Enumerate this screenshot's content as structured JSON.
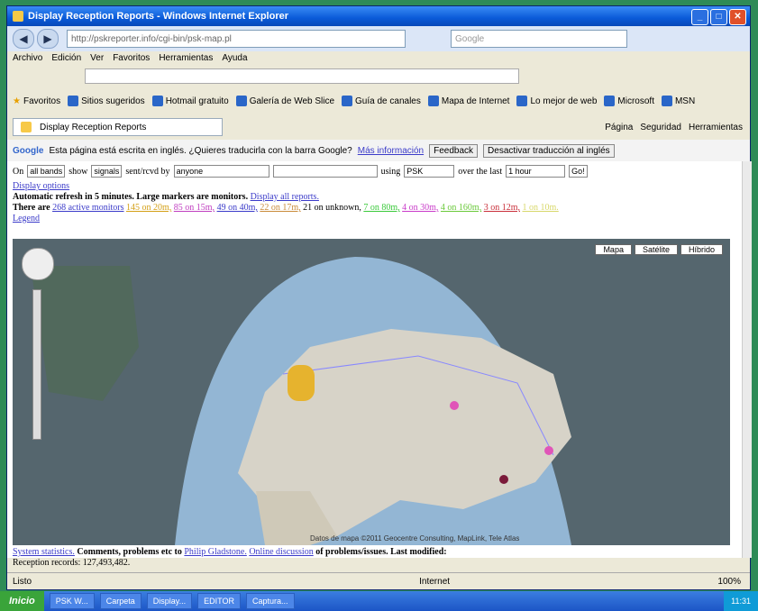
{
  "window": {
    "title": "Display Reception Reports - Windows Internet Explorer"
  },
  "address": {
    "url": "http://pskreporter.info/cgi-bin/psk-map.pl",
    "search_placeholder": "Google"
  },
  "menu": [
    "Archivo",
    "Edición",
    "Ver",
    "Favoritos",
    "Herramientas",
    "Ayuda"
  ],
  "favorites": {
    "label": "Favoritos",
    "items": [
      "Sitios sugeridos",
      "Hotmail gratuito",
      "Galería de Web Slice",
      "Guía de canales",
      "Mapa de Internet",
      "Lo mejor de web",
      "Microsoft",
      "MSN"
    ]
  },
  "tab": {
    "label": "Display Reception Reports"
  },
  "tools": [
    "Página",
    "Seguridad",
    "Herramientas"
  ],
  "translate": {
    "message": "Esta página está escrita en inglés. ¿Quieres traducirla con la barra Google?",
    "more_info": "Más información",
    "feedback": "Feedback",
    "button": "Desactivar traducción al inglés"
  },
  "controls": {
    "on": "On",
    "on_value": "all bands",
    "show": "show",
    "show_value": "signals",
    "sent": "sent/rcvd by",
    "sent_value": "anyone",
    "using": "using",
    "using_value": "PSK",
    "over": "over the last",
    "over_value": "1 hour",
    "go": "Go!"
  },
  "links": {
    "display_options": "Display options",
    "auto_refresh": "Automatic refresh in 5 minutes. Large markers are monitors.",
    "display_all": "Display all reports.",
    "there_are": "There are",
    "active_monitors": "268 active monitors",
    "bands": [
      "145 on 20m,",
      "85 on 15m,",
      "49 on 40m,",
      "22 on 17m,",
      "21 on unknown,",
      "7 on 80m,",
      "4 on 30m,",
      "4 on 160m,",
      "3 on 12m,",
      "1 on 10m."
    ],
    "legend": "Legend"
  },
  "map": {
    "buttons": [
      "Mapa",
      "Satélite",
      "Híbrido"
    ],
    "attribution": "Datos de mapa ©2011 Geocentre Consulting, MapLink, Tele Atlas"
  },
  "footer": {
    "stats": "System statistics.",
    "comments": "Comments, problems etc to",
    "philip": "Philip Gladstone.",
    "online": "Online discussion",
    "problems": "of problems/issues. Last modified:",
    "reception": "Reception records: 127,493,482."
  },
  "statusbar": {
    "left": "Listo",
    "zone": "Internet",
    "zoom": "100%"
  },
  "taskbar": {
    "start": "Inicio",
    "tasks": [
      "PSK W...",
      "Carpeta",
      "Display...",
      "EDITOR",
      "Captura..."
    ],
    "clock": "11:31"
  }
}
